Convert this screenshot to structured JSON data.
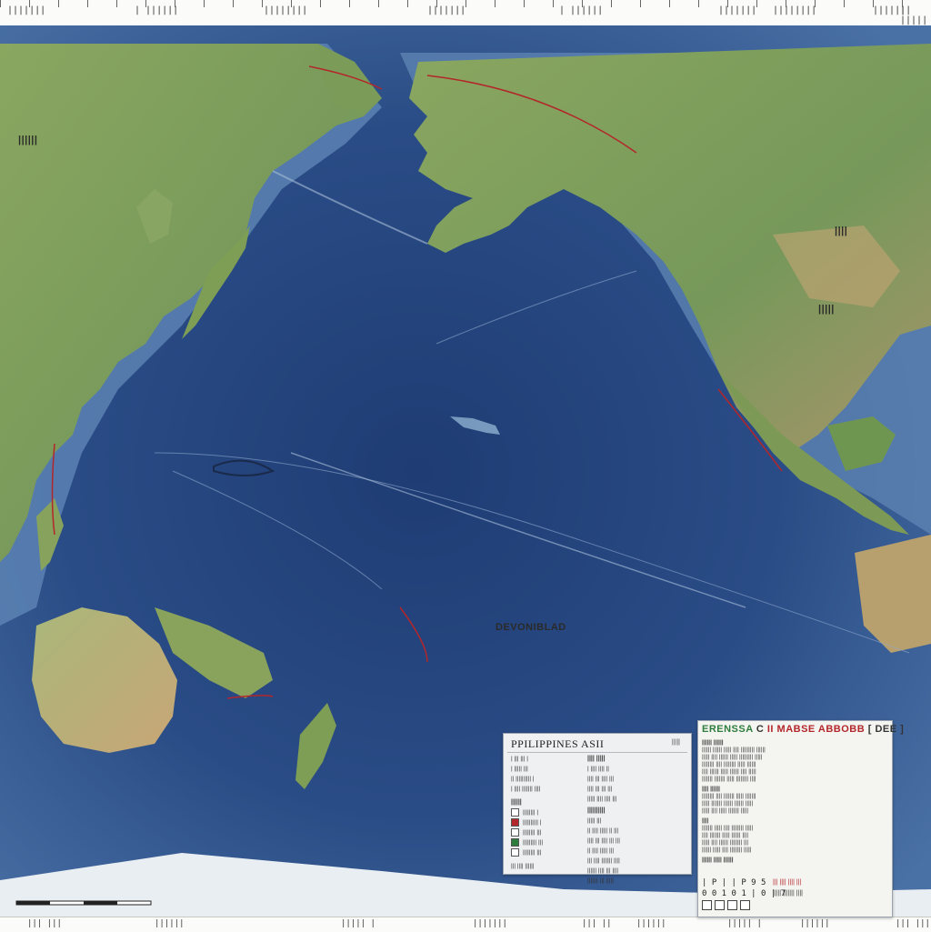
{
  "top_ruler": {
    "labels": [
      "|||||||",
      "| ||||||",
      "||||||||",
      "|||||||",
      "| ||||||",
      "|||||||",
      "||||||||",
      "|||||||",
      "| |||||"
    ]
  },
  "bottom_ruler": {
    "labels": [
      "||| |||",
      "||||||",
      "||||| |",
      "|||||||",
      "||| ||",
      "||||||",
      "||||| |",
      "||||||",
      "||| |||"
    ]
  },
  "map": {
    "label_pacific": "DEVONIBLAD",
    "label_na": "||||",
    "label_na2": "|||||",
    "label_asia": "||||||"
  },
  "panel_left": {
    "title": "PPILIPPINES ASII",
    "tag": "|||||",
    "col1": {
      "rows": [
        "| ||| ||| |",
        "|  ||||| |||",
        "||  |||||||||| |",
        "| |||| ||||||| ||||"
      ],
      "header": "||||||",
      "swatch_rows": [
        "|||||||| |",
        "||||||||||  |",
        "|||||||| |||",
        "||||||||| |||",
        "|||||||| |||"
      ],
      "footer": "||| |||| ||||||"
    },
    "col2": {
      "header": "|||| |||||",
      "rows": [
        "| |||| |||| ||",
        "|||| ||| |||| |||",
        "|||| ||| ||| |||",
        "||||| |||| |||| |||"
      ],
      "header2": "||||||||||",
      "rows2": [
        "||||| |||",
        "|| |||| ||||| || |||",
        "|||| ||| |||| ||| |||",
        "|| |||| ||||| |||",
        "||| |||| ||||||| ||||",
        "|||||| |||| ||| ||||"
      ],
      "footer": "||||||| ||| |||||"
    }
  },
  "panel_right": {
    "title_a": "ERENSSA",
    "title_b": "C",
    "title_c": "II MABSE ABBOBB",
    "title_d": "[ DEE ]",
    "subtitle": "|||||| ||||||",
    "lines": [
      "|||||| |||||| ||||| |||| ||||||||| ||||||",
      "||||| |||| |||||| ||||| ||||||||| |||||",
      "|||||||| |||| |||||||| ||||| ||||||",
      "|||| |||||| ||||| |||||| |||| |||||",
      "||||||| ||||||| ||||| |||||||| ||||"
    ],
    "sec1": "|||| ||||||",
    "lines2": [
      "|||||||| |||| ||||||| ||||| |||||||",
      "||||| ||||||| |||||| |||||| |||||",
      "||||| |||| ||||| ||||||| |||||"
    ],
    "sec2": "||||",
    "lines3": [
      "||||||| ||||| |||| |||||||| |||||",
      "|||| ||||||| ||||| |||||| ||||",
      "||||| |||| |||||| |||||||| |||",
      "|||||| ||||| |||| |||||||| |||||"
    ],
    "sec3": "|||||| ||||| ||||||",
    "foot_a": "| P | | P 9 5",
    "foot_b": "0 0 1 0   1   | 0 | 7",
    "foot_r1": "||| |||| |||| |||",
    "foot_r2": "||||| ||||||| ||||",
    "colors": {
      "green": "#2f7d3c",
      "red": "#b3262a"
    }
  },
  "colors": {
    "ocean_deep": "#27467f",
    "ocean_mid": "#3a5f96",
    "ocean_shelf": "#6f93bd",
    "land_green": "#7f9e55",
    "land_tan": "#b9a272",
    "fault_red": "#b3262a"
  }
}
